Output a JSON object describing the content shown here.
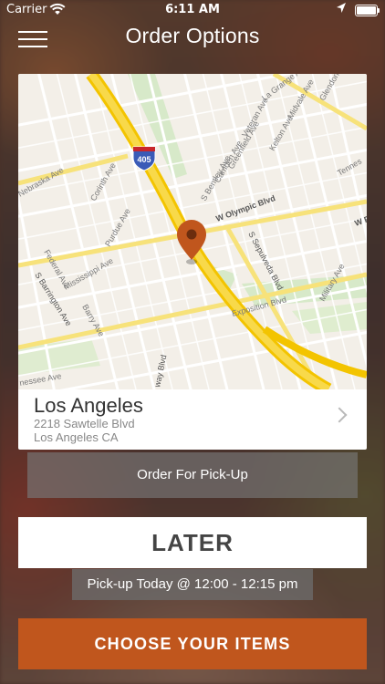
{
  "status_bar": {
    "carrier": "Carrier",
    "time": "6:11 AM"
  },
  "header": {
    "title": "Order Options"
  },
  "map": {
    "streets": {
      "la_grange": "La Grange Av",
      "midvale": "Midvale Ave",
      "glendon": "Glendon Av",
      "veteran": "Veteran Ave",
      "kelton": "Kelton Ave",
      "greenfield": "Greenfield Ave",
      "camden": "Camden Ave",
      "bentley": "S Bentley Ave",
      "tennessee": "Tennes",
      "nebraska": "Nebraska Ave",
      "corinth": "Corinth Ave",
      "purdue": "Purdue Ave",
      "olympic": "W Olympic Blvd",
      "sepulveda": "S Sepulveda Blvd",
      "federal": "Federal Ave",
      "mississippi": "Mississippi Ave",
      "barrington": "S Barrington Ave",
      "barry": "Barry Ave",
      "military": "Military Ave",
      "exposition": "Exposition Blvd",
      "w_p": "W P",
      "way_blvd": "way Blvd",
      "nessee": "nessee Ave",
      "interstate": "405"
    }
  },
  "location": {
    "name": "Los Angeles",
    "address_line1": "2218 Sawtelle Blvd",
    "address_line2": "Los Angeles CA"
  },
  "buttons": {
    "order_type": "Order For Pick-Up",
    "timing": "LATER",
    "choose_items": "CHOOSE YOUR ITEMS"
  },
  "pickup_time": "Pick-up Today @ 12:00 - 12:15 pm",
  "colors": {
    "accent": "#c0561d",
    "pin": "#c0561d",
    "freeway": "#f5d042"
  },
  "icons": {
    "menu": "hamburger-icon",
    "wifi": "wifi-icon",
    "location": "location-arrow-icon",
    "battery": "battery-icon",
    "pin": "map-pin-icon",
    "chevron": "chevron-right-icon"
  }
}
